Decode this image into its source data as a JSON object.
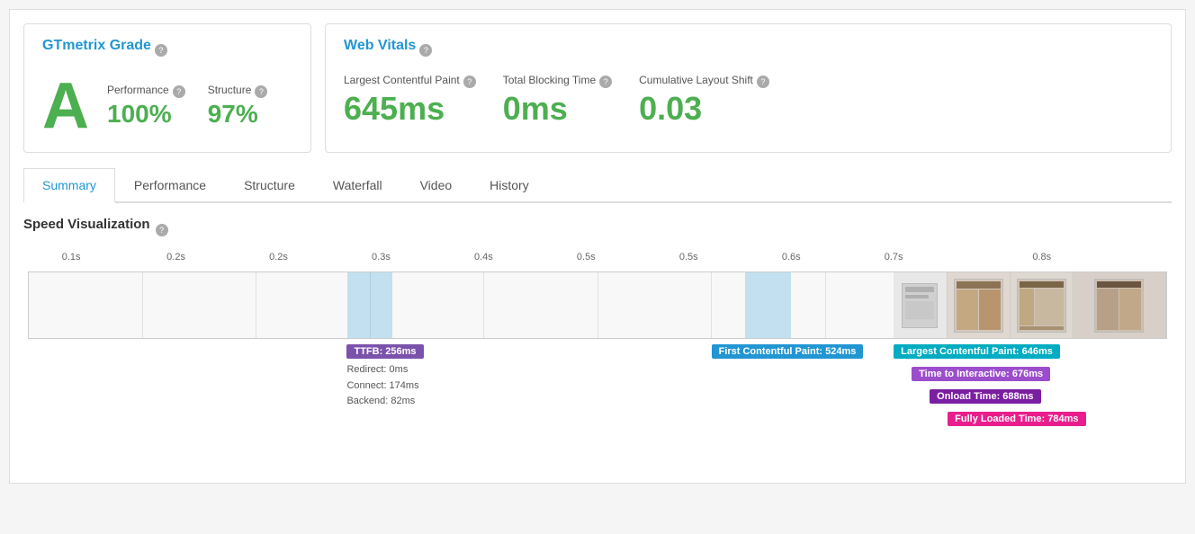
{
  "gtmetrix": {
    "section_title": "GTmetrix Grade",
    "help_icon": "?",
    "grade": "A",
    "performance_label": "Performance",
    "performance_value": "100%",
    "structure_label": "Structure",
    "structure_value": "97%"
  },
  "web_vitals": {
    "section_title": "Web Vitals",
    "help_icon": "?",
    "lcp_label": "Largest Contentful Paint",
    "lcp_value": "645ms",
    "tbt_label": "Total Blocking Time",
    "tbt_value": "0ms",
    "cls_label": "Cumulative Layout Shift",
    "cls_value": "0.03"
  },
  "tabs": [
    {
      "label": "Summary",
      "active": true
    },
    {
      "label": "Performance",
      "active": false
    },
    {
      "label": "Structure",
      "active": false
    },
    {
      "label": "Waterfall",
      "active": false
    },
    {
      "label": "Video",
      "active": false
    },
    {
      "label": "History",
      "active": false
    }
  ],
  "speed_viz": {
    "title": "Speed Visualization",
    "help_icon": "?",
    "timeline_labels": [
      "0.1s",
      "0.2s",
      "0.2s",
      "0.3s",
      "0.4s",
      "0.5s",
      "0.5s",
      "0.6s",
      "0.7s",
      "0.8s"
    ],
    "annotations": {
      "ttfb": "TTFB: 256ms",
      "redirect": "Redirect: 0ms",
      "connect": "Connect: 174ms",
      "backend": "Backend: 82ms",
      "fcp": "First Contentful Paint: 524ms",
      "lcp": "Largest Contentful Paint: 646ms",
      "tti": "Time to Interactive: 676ms",
      "onload": "Onload Time: 688ms",
      "fully_loaded": "Fully Loaded Time: 784ms"
    }
  }
}
